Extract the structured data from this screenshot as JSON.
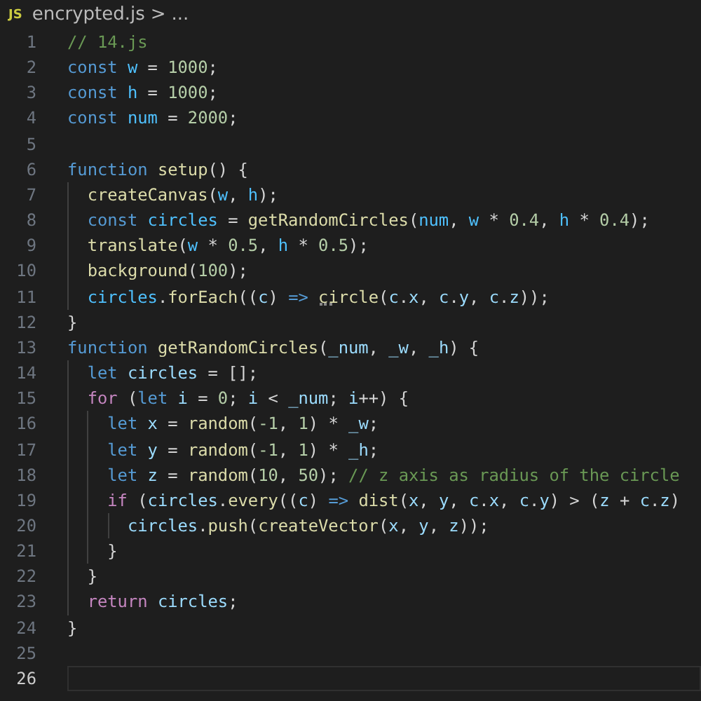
{
  "breadcrumb": {
    "file_icon": "JS",
    "file": "encrypted.js",
    "separator": ">",
    "more": "..."
  },
  "lines": [
    {
      "number": "1",
      "current": false,
      "tokens": [
        {
          "t": "// 14.js",
          "kind": "comment"
        }
      ]
    },
    {
      "number": "2",
      "current": false,
      "tokens": [
        {
          "t": "const",
          "kind": "keyword"
        },
        {
          "t": " w",
          "kind": "constant"
        },
        {
          "t": " = ",
          "kind": "plain"
        },
        {
          "t": "1000",
          "kind": "number"
        },
        {
          "t": ";",
          "kind": "plain"
        }
      ]
    },
    {
      "number": "3",
      "current": false,
      "tokens": [
        {
          "t": "const",
          "kind": "keyword"
        },
        {
          "t": " h",
          "kind": "constant"
        },
        {
          "t": " = ",
          "kind": "plain"
        },
        {
          "t": "1000",
          "kind": "number"
        },
        {
          "t": ";",
          "kind": "plain"
        }
      ]
    },
    {
      "number": "4",
      "current": false,
      "tokens": [
        {
          "t": "const",
          "kind": "keyword"
        },
        {
          "t": " num",
          "kind": "constant"
        },
        {
          "t": " = ",
          "kind": "plain"
        },
        {
          "t": "2000",
          "kind": "number"
        },
        {
          "t": ";",
          "kind": "plain"
        }
      ]
    },
    {
      "number": "5",
      "current": false
    },
    {
      "number": "6",
      "current": false,
      "tokens": [
        {
          "t": "function",
          "kind": "keyword"
        },
        {
          "t": " setup",
          "kind": "function"
        },
        {
          "t": "() {",
          "kind": "plain"
        }
      ]
    },
    {
      "number": "7",
      "current": false,
      "tokens": [
        {
          "t": "  createCanvas",
          "kind": "function"
        },
        {
          "t": "(",
          "kind": "plain"
        },
        {
          "t": "w",
          "kind": "constant"
        },
        {
          "t": ", ",
          "kind": "plain"
        },
        {
          "t": "h",
          "kind": "constant"
        },
        {
          "t": ");",
          "kind": "plain"
        }
      ]
    },
    {
      "number": "8",
      "current": false,
      "tokens": [
        {
          "t": "  const",
          "kind": "keyword"
        },
        {
          "t": " circles",
          "kind": "constant"
        },
        {
          "t": " = ",
          "kind": "plain"
        },
        {
          "t": "getRandomCircles",
          "kind": "function"
        },
        {
          "t": "(",
          "kind": "plain"
        },
        {
          "t": "num",
          "kind": "constant"
        },
        {
          "t": ", ",
          "kind": "plain"
        },
        {
          "t": "w",
          "kind": "constant"
        },
        {
          "t": " * ",
          "kind": "plain"
        },
        {
          "t": "0.4",
          "kind": "number"
        },
        {
          "t": ", ",
          "kind": "plain"
        },
        {
          "t": "h",
          "kind": "constant"
        },
        {
          "t": " * ",
          "kind": "plain"
        },
        {
          "t": "0.4",
          "kind": "number"
        },
        {
          "t": ");",
          "kind": "plain"
        }
      ]
    },
    {
      "number": "9",
      "current": false,
      "tokens": [
        {
          "t": "  translate",
          "kind": "function"
        },
        {
          "t": "(",
          "kind": "plain"
        },
        {
          "t": "w",
          "kind": "constant"
        },
        {
          "t": " * ",
          "kind": "plain"
        },
        {
          "t": "0.5",
          "kind": "number"
        },
        {
          "t": ", ",
          "kind": "plain"
        },
        {
          "t": "h",
          "kind": "constant"
        },
        {
          "t": " * ",
          "kind": "plain"
        },
        {
          "t": "0.5",
          "kind": "number"
        },
        {
          "t": ");",
          "kind": "plain"
        }
      ]
    },
    {
      "number": "10",
      "current": false,
      "tokens": [
        {
          "t": "  background",
          "kind": "function"
        },
        {
          "t": "(",
          "kind": "plain"
        },
        {
          "t": "100",
          "kind": "number"
        },
        {
          "t": ");",
          "kind": "plain"
        }
      ]
    },
    {
      "number": "11",
      "current": false,
      "tokens": [
        {
          "t": "  circles",
          "kind": "constant"
        },
        {
          "t": ".",
          "kind": "plain"
        },
        {
          "t": "forEach",
          "kind": "function"
        },
        {
          "t": "((",
          "kind": "plain"
        },
        {
          "t": "c",
          "kind": "variable"
        },
        {
          "t": ") ",
          "kind": "plain"
        },
        {
          "t": "=>",
          "kind": "keyword"
        },
        {
          "t": " circle",
          "kind": "function",
          "hint": true
        },
        {
          "t": "(",
          "kind": "plain"
        },
        {
          "t": "c",
          "kind": "variable"
        },
        {
          "t": ".",
          "kind": "plain"
        },
        {
          "t": "x",
          "kind": "variable"
        },
        {
          "t": ", ",
          "kind": "plain"
        },
        {
          "t": "c",
          "kind": "variable"
        },
        {
          "t": ".",
          "kind": "plain"
        },
        {
          "t": "y",
          "kind": "variable"
        },
        {
          "t": ", ",
          "kind": "plain"
        },
        {
          "t": "c",
          "kind": "variable"
        },
        {
          "t": ".",
          "kind": "plain"
        },
        {
          "t": "z",
          "kind": "variable"
        },
        {
          "t": "));",
          "kind": "plain"
        }
      ]
    },
    {
      "number": "12",
      "current": false,
      "tokens": [
        {
          "t": "}",
          "kind": "plain"
        }
      ]
    },
    {
      "number": "13",
      "current": false,
      "tokens": [
        {
          "t": "function",
          "kind": "keyword"
        },
        {
          "t": " getRandomCircles",
          "kind": "function"
        },
        {
          "t": "(",
          "kind": "plain"
        },
        {
          "t": "_num",
          "kind": "variable"
        },
        {
          "t": ", ",
          "kind": "plain"
        },
        {
          "t": "_w",
          "kind": "variable"
        },
        {
          "t": ", ",
          "kind": "plain"
        },
        {
          "t": "_h",
          "kind": "variable"
        },
        {
          "t": ") {",
          "kind": "plain"
        }
      ]
    },
    {
      "number": "14",
      "current": false,
      "tokens": [
        {
          "t": "  let",
          "kind": "keyword"
        },
        {
          "t": " circles",
          "kind": "variable"
        },
        {
          "t": " = [];",
          "kind": "plain"
        }
      ]
    },
    {
      "number": "15",
      "current": false,
      "tokens": [
        {
          "t": "  for",
          "kind": "control"
        },
        {
          "t": " (",
          "kind": "plain"
        },
        {
          "t": "let",
          "kind": "keyword"
        },
        {
          "t": " i",
          "kind": "variable"
        },
        {
          "t": " = ",
          "kind": "plain"
        },
        {
          "t": "0",
          "kind": "number"
        },
        {
          "t": "; ",
          "kind": "plain"
        },
        {
          "t": "i",
          "kind": "variable"
        },
        {
          "t": " < ",
          "kind": "plain"
        },
        {
          "t": "_num",
          "kind": "variable"
        },
        {
          "t": "; ",
          "kind": "plain"
        },
        {
          "t": "i",
          "kind": "variable"
        },
        {
          "t": "++) {",
          "kind": "plain"
        }
      ]
    },
    {
      "number": "16",
      "current": false,
      "tokens": [
        {
          "t": "    let",
          "kind": "keyword"
        },
        {
          "t": " x",
          "kind": "variable"
        },
        {
          "t": " = ",
          "kind": "plain"
        },
        {
          "t": "random",
          "kind": "function"
        },
        {
          "t": "(",
          "kind": "plain"
        },
        {
          "t": "-1",
          "kind": "number"
        },
        {
          "t": ", ",
          "kind": "plain"
        },
        {
          "t": "1",
          "kind": "number"
        },
        {
          "t": ") * ",
          "kind": "plain"
        },
        {
          "t": "_w",
          "kind": "variable"
        },
        {
          "t": ";",
          "kind": "plain"
        }
      ]
    },
    {
      "number": "17",
      "current": false,
      "tokens": [
        {
          "t": "    let",
          "kind": "keyword"
        },
        {
          "t": " y",
          "kind": "variable"
        },
        {
          "t": " = ",
          "kind": "plain"
        },
        {
          "t": "random",
          "kind": "function"
        },
        {
          "t": "(",
          "kind": "plain"
        },
        {
          "t": "-1",
          "kind": "number"
        },
        {
          "t": ", ",
          "kind": "plain"
        },
        {
          "t": "1",
          "kind": "number"
        },
        {
          "t": ") * ",
          "kind": "plain"
        },
        {
          "t": "_h",
          "kind": "variable"
        },
        {
          "t": ";",
          "kind": "plain"
        }
      ]
    },
    {
      "number": "18",
      "current": false,
      "tokens": [
        {
          "t": "    let",
          "kind": "keyword"
        },
        {
          "t": " z",
          "kind": "variable"
        },
        {
          "t": " = ",
          "kind": "plain"
        },
        {
          "t": "random",
          "kind": "function"
        },
        {
          "t": "(",
          "kind": "plain"
        },
        {
          "t": "10",
          "kind": "number"
        },
        {
          "t": ", ",
          "kind": "plain"
        },
        {
          "t": "50",
          "kind": "number"
        },
        {
          "t": "); ",
          "kind": "plain"
        },
        {
          "t": "// z axis as radius of the circle",
          "kind": "comment"
        }
      ]
    },
    {
      "number": "19",
      "current": false,
      "tokens": [
        {
          "t": "    if",
          "kind": "control"
        },
        {
          "t": " (",
          "kind": "plain"
        },
        {
          "t": "circles",
          "kind": "variable"
        },
        {
          "t": ".",
          "kind": "plain"
        },
        {
          "t": "every",
          "kind": "function"
        },
        {
          "t": "((",
          "kind": "plain"
        },
        {
          "t": "c",
          "kind": "variable"
        },
        {
          "t": ") ",
          "kind": "plain"
        },
        {
          "t": "=>",
          "kind": "keyword"
        },
        {
          "t": " dist",
          "kind": "function"
        },
        {
          "t": "(",
          "kind": "plain"
        },
        {
          "t": "x",
          "kind": "variable"
        },
        {
          "t": ", ",
          "kind": "plain"
        },
        {
          "t": "y",
          "kind": "variable"
        },
        {
          "t": ", ",
          "kind": "plain"
        },
        {
          "t": "c",
          "kind": "variable"
        },
        {
          "t": ".",
          "kind": "plain"
        },
        {
          "t": "x",
          "kind": "variable"
        },
        {
          "t": ", ",
          "kind": "plain"
        },
        {
          "t": "c",
          "kind": "variable"
        },
        {
          "t": ".",
          "kind": "plain"
        },
        {
          "t": "y",
          "kind": "variable"
        },
        {
          "t": ") > (",
          "kind": "plain"
        },
        {
          "t": "z",
          "kind": "variable"
        },
        {
          "t": " + ",
          "kind": "plain"
        },
        {
          "t": "c",
          "kind": "variable"
        },
        {
          "t": ".",
          "kind": "plain"
        },
        {
          "t": "z",
          "kind": "variable"
        },
        {
          "t": ")",
          "kind": "plain"
        }
      ]
    },
    {
      "number": "20",
      "current": false,
      "tokens": [
        {
          "t": "      circles",
          "kind": "variable"
        },
        {
          "t": ".",
          "kind": "plain"
        },
        {
          "t": "push",
          "kind": "function"
        },
        {
          "t": "(",
          "kind": "plain"
        },
        {
          "t": "createVector",
          "kind": "function"
        },
        {
          "t": "(",
          "kind": "plain"
        },
        {
          "t": "x",
          "kind": "variable"
        },
        {
          "t": ", ",
          "kind": "plain"
        },
        {
          "t": "y",
          "kind": "variable"
        },
        {
          "t": ", ",
          "kind": "plain"
        },
        {
          "t": "z",
          "kind": "variable"
        },
        {
          "t": "));",
          "kind": "plain"
        }
      ]
    },
    {
      "number": "21",
      "current": false,
      "tokens": [
        {
          "t": "    }",
          "kind": "plain"
        }
      ]
    },
    {
      "number": "22",
      "current": false,
      "tokens": [
        {
          "t": "  }",
          "kind": "plain"
        }
      ]
    },
    {
      "number": "23",
      "current": false,
      "tokens": [
        {
          "t": "  return",
          "kind": "control"
        },
        {
          "t": " circles",
          "kind": "variable"
        },
        {
          "t": ";",
          "kind": "plain"
        }
      ]
    },
    {
      "number": "24",
      "current": false,
      "tokens": [
        {
          "t": "}",
          "kind": "plain"
        }
      ]
    },
    {
      "number": "25",
      "current": false
    },
    {
      "number": "26",
      "current": true
    }
  ]
}
